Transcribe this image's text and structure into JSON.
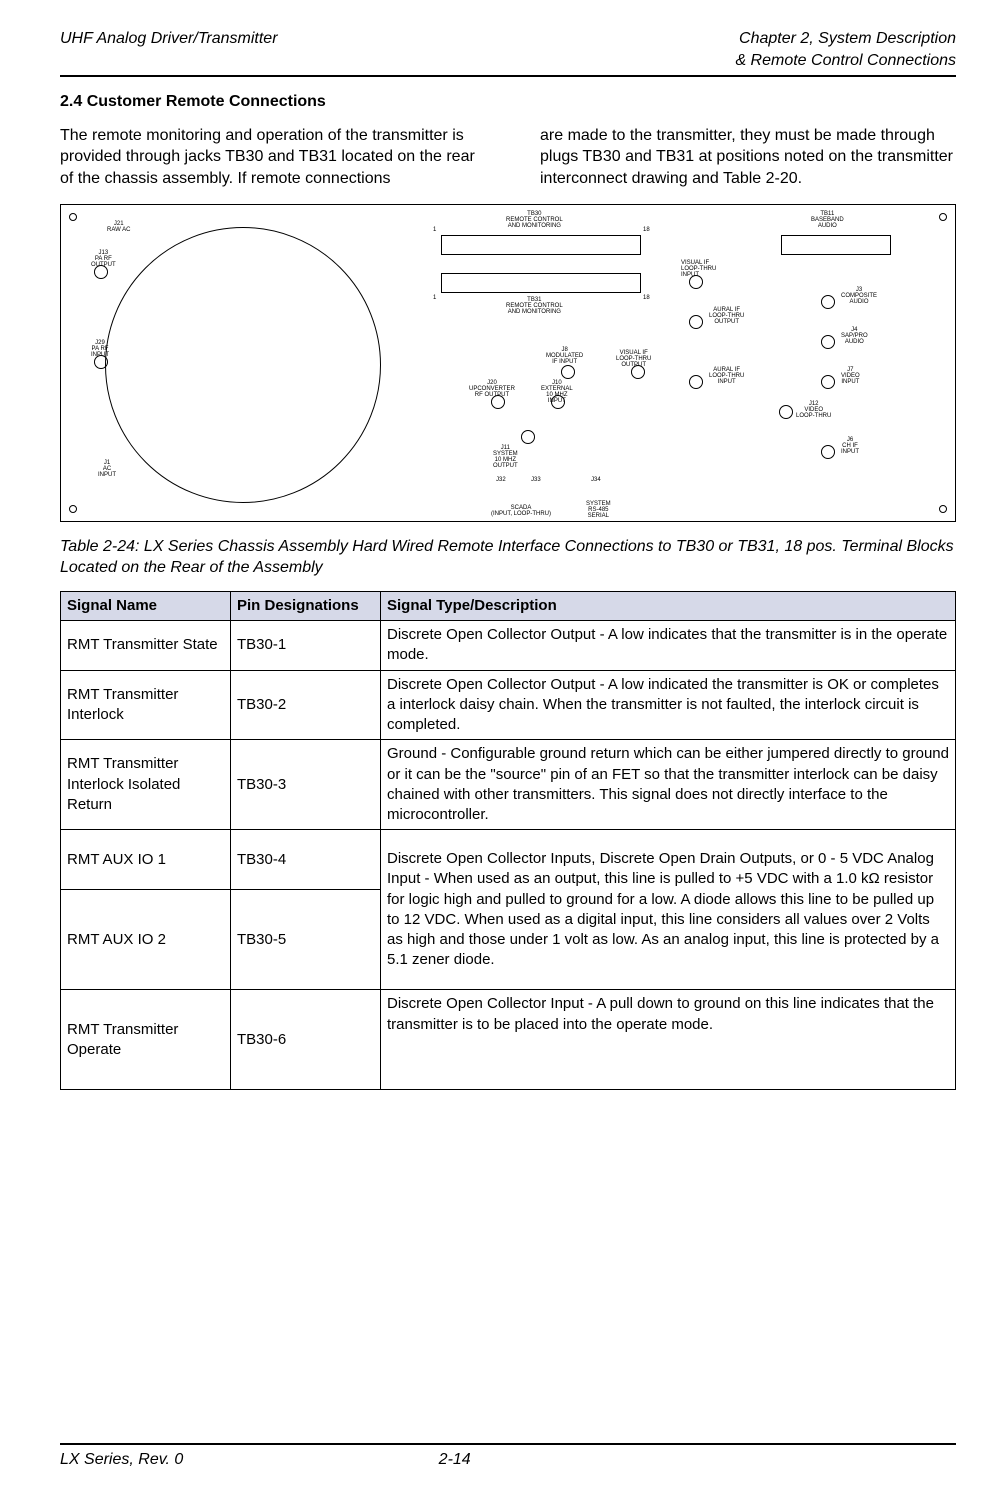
{
  "header": {
    "left": "UHF Analog Driver/Transmitter",
    "right_line1": "Chapter 2, System Description",
    "right_line2": "& Remote Control Connections"
  },
  "section": {
    "number": "2.4",
    "title": "Customer Remote Connections",
    "full": "2.4 Customer Remote Connections"
  },
  "body": {
    "col1": "The remote monitoring and operation of the transmitter is provided through jacks TB30 and TB31 located on the rear of the chassis assembly. If remote connections",
    "col2": "are made to the transmitter, they must be made through plugs TB30 and TB31 at positions noted on the transmitter interconnect drawing and Table 2-20."
  },
  "figure_labels": {
    "tb30": "TB30\nREMOTE CONTROL\nAND MONITORING",
    "tb31": "TB31\nREMOTE CONTROL\nAND MONITORING",
    "j21": "J21\nRAW AC",
    "j13": "J13\nPA RF\nOUTPUT",
    "j29": "J29\nPA RF\nINPUT",
    "j1": "J1\nAC\nINPUT",
    "tb11": "TB11\nBASEBAND\nAUDIO",
    "j15": "VISUAL IF\nLOOP-THRU\nINPUT",
    "j14": "AURAL IF\nLOOP-THRU\nOUTPUT",
    "j18": "VISUAL IF\nLOOP-THRU\nOUTPUT",
    "j19": "AURAL IF\nLOOP-THRU\nINPUT",
    "j3": "J3\nCOMPOSITE\nAUDIO",
    "j4": "J4\nSAP/PRO\nAUDIO",
    "j7": "J7\nVIDEO\nINPUT",
    "j12": "J12\nVIDEO\nLOOP-THRU",
    "j6": "J6\nCH IF\nINPUT",
    "j8": "J8\nMODULATED\nIF INPUT",
    "j20": "J20\nUPCONVERTER\nRF OUTPUT",
    "j10": "J10\nEXTERNAL\n10 MHZ\nINPUT",
    "j11": "J11\nSYSTEM\n10 MHZ\nOUTPUT",
    "j32": "J32",
    "j33": "J33",
    "j34": "J34",
    "scada": "SCADA\n(INPUT, LOOP-THRU)",
    "rs485": "SYSTEM\nRS-485\nSERIAL"
  },
  "table": {
    "caption": "Table 2-24: LX Series Chassis Assembly Hard Wired Remote Interface Connections to TB30 or TB31, 18 pos. Terminal Blocks Located on the Rear of the Assembly",
    "headers": {
      "signal": "Signal Name",
      "pin": "Pin Designations",
      "desc": "Signal Type/Description"
    },
    "rows": [
      {
        "signal": "RMT Transmitter State",
        "pin": "TB30-1",
        "desc": "Discrete Open Collector Output - A low indicates that the transmitter is in the operate mode."
      },
      {
        "signal": "RMT Transmitter Interlock",
        "pin": "TB30-2",
        "desc": "Discrete Open Collector Output - A low indicated the transmitter is OK or completes a interlock daisy chain. When the transmitter is not faulted, the interlock circuit is completed."
      },
      {
        "signal": "RMT Transmitter Interlock Isolated Return",
        "pin": "TB30-3",
        "desc": "Ground - Configurable ground return which can be either jumpered directly to ground or it can be the \"source\" pin of an FET so that the transmitter interlock can be daisy chained with other transmitters.  This signal does not directly interface to the microcontroller."
      },
      {
        "signal": "RMT AUX IO 1",
        "pin": "TB30-4",
        "desc": "Discrete Open Collector Inputs, Discrete Open Drain Outputs, or 0 - 5 VDC Analog Input - When used as an output, this line is pulled to +5 VDC with a 1.0 kΩ resistor for logic high and pulled to ground for a low.  A diode allows this line to be pulled up to 12 VDC.  When used as a digital input, this line considers all values over 2 Volts as high and those under 1 volt as low.  As an analog input, this line is protected by a 5.1 zener diode."
      },
      {
        "signal": "RMT AUX IO 2",
        "pin": "TB30-5",
        "desc": ""
      },
      {
        "signal": "RMT Transmitter Operate",
        "pin": "TB30-6",
        "desc": "Discrete Open Collector Input - A pull down to ground on this line indicates that the transmitter is to be placed into the operate mode."
      }
    ]
  },
  "footer": {
    "left": "LX Series, Rev. 0",
    "center": "2-14"
  }
}
